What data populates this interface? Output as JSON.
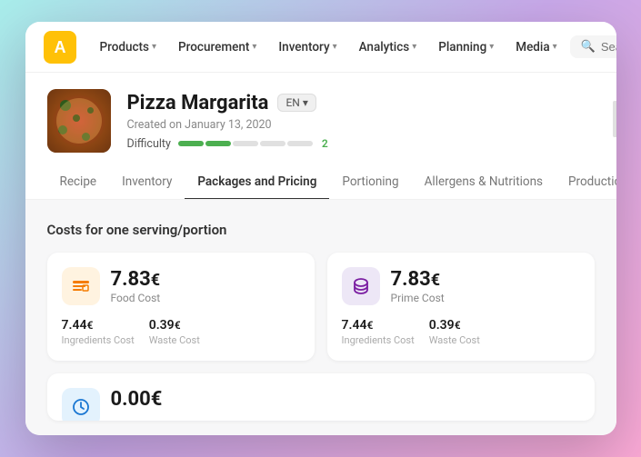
{
  "nav": {
    "logo_text": "A",
    "items": [
      {
        "label": "Products",
        "has_chevron": true
      },
      {
        "label": "Procurement",
        "has_chevron": true
      },
      {
        "label": "Inventory",
        "has_chevron": true
      },
      {
        "label": "Analytics",
        "has_chevron": true
      },
      {
        "label": "Planning",
        "has_chevron": true
      },
      {
        "label": "Media",
        "has_chevron": true
      }
    ],
    "search_placeholder": "Search"
  },
  "product": {
    "name": "Pizza Margarita",
    "lang": "EN",
    "created": "Created on January 13, 2020",
    "difficulty_label": "Difficulty",
    "difficulty_value": "2"
  },
  "sub_tabs": [
    {
      "label": "Recipe",
      "active": false
    },
    {
      "label": "Inventory",
      "active": false
    },
    {
      "label": "Packages and Pricing",
      "active": true
    },
    {
      "label": "Portioning",
      "active": false
    },
    {
      "label": "Allergens & Nutritions",
      "active": false
    },
    {
      "label": "Production T",
      "active": false
    }
  ],
  "main": {
    "section_title": "Costs for one serving/portion",
    "food_cost": {
      "icon": "🍽",
      "main_value": "7.83",
      "currency": "€",
      "label": "Food Cost",
      "sub_items": [
        {
          "value": "7.44",
          "currency": "€",
          "label": "Ingredients Cost"
        },
        {
          "value": "0.39",
          "currency": "€",
          "label": "Waste Cost"
        }
      ]
    },
    "prime_cost": {
      "icon": "🗄",
      "main_value": "7.83",
      "currency": "€",
      "label": "Prime Cost",
      "sub_items": [
        {
          "value": "7.44",
          "currency": "€",
          "label": "Ingredients Cost"
        },
        {
          "value": "0.39",
          "currency": "€",
          "label": "Waste Cost"
        }
      ]
    },
    "labour_cost": {
      "icon": "⏱",
      "main_value": "0.00",
      "currency": "€"
    }
  }
}
